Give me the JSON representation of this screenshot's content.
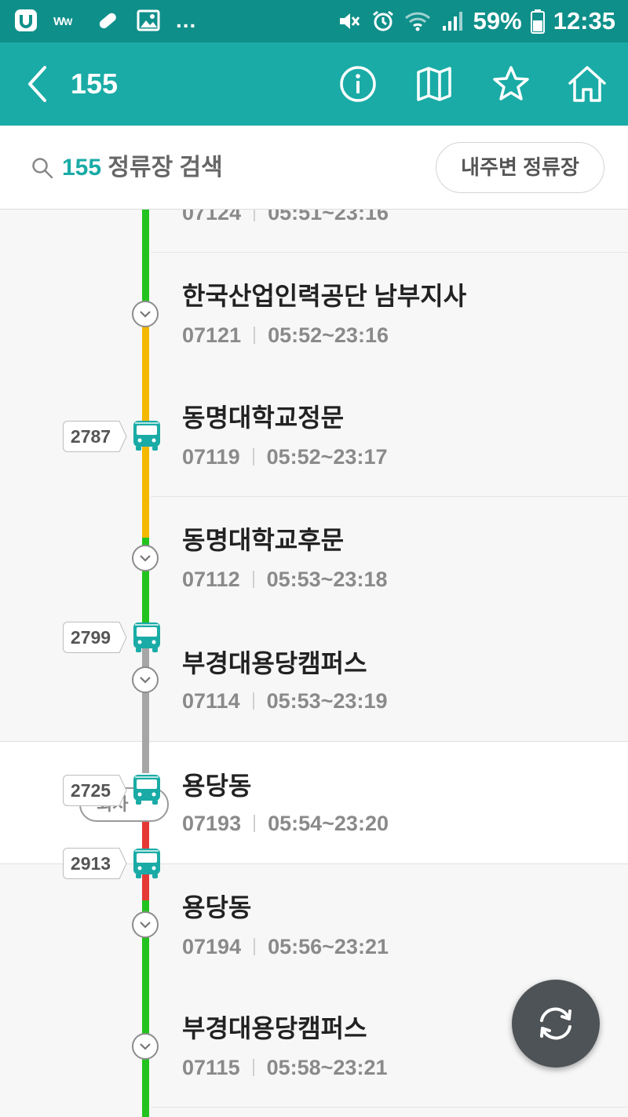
{
  "status_bar": {
    "battery": "59%",
    "time": "12:35",
    "overflow": "...",
    "icons": [
      "uplus-icon",
      "wifi-text-icon",
      "pill-icon",
      "image-icon",
      "mute-icon",
      "alarm-icon",
      "wifi-icon",
      "signal-icon",
      "battery-icon"
    ]
  },
  "header": {
    "title": "155",
    "actions": [
      "info-icon",
      "map-icon",
      "star-icon",
      "home-icon"
    ]
  },
  "search": {
    "route": "155",
    "label": " 정류장 검색",
    "nearby_button": "내주변 정류장"
  },
  "colors": {
    "status_bar": "#0f8f8a",
    "header": "#1aaba6",
    "smooth": "#22c31f",
    "slow": "#f5b800",
    "congested": "#e53935",
    "unknown": "#a6a6a6",
    "bus": "#1aaba6"
  },
  "stops": [
    {
      "name": "",
      "id": "07124",
      "hours": "05:51~23:16"
    },
    {
      "name": "한국산업인력공단 남부지사",
      "id": "07121",
      "hours": "05:52~23:16"
    },
    {
      "name": "동명대학교정문",
      "id": "07119",
      "hours": "05:52~23:17"
    },
    {
      "name": "동명대학교후문",
      "id": "07112",
      "hours": "05:53~23:18"
    },
    {
      "name": "부경대용당캠퍼스",
      "id": "07114",
      "hours": "05:53~23:19"
    },
    {
      "name": "용당동",
      "id": "07193",
      "hours": "05:54~23:20"
    },
    {
      "name": "용당동",
      "id": "07194",
      "hours": "05:56~23:21"
    },
    {
      "name": "부경대용당캠퍼스",
      "id": "07115",
      "hours": "05:58~23:21"
    }
  ],
  "buses": [
    {
      "plate": "2787"
    },
    {
      "plate": "2799"
    },
    {
      "plate": "2725"
    },
    {
      "plate": "2913"
    }
  ],
  "transfer_label": "회차",
  "refresh_button": "refresh-icon"
}
